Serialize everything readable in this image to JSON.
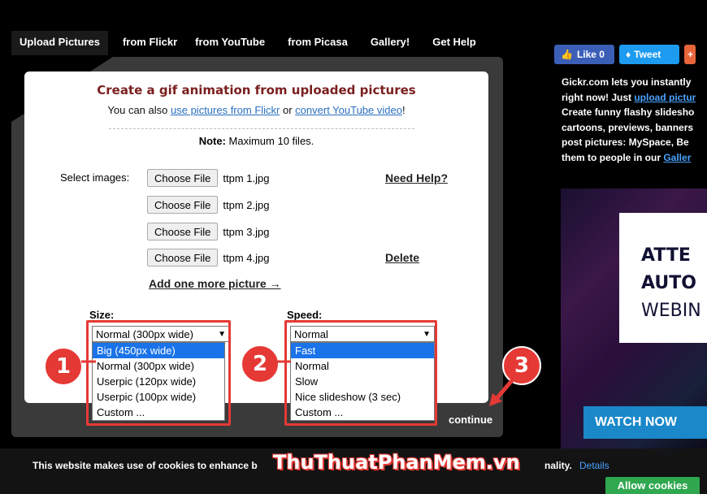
{
  "nav": [
    "Upload Pictures",
    "from Flickr",
    "from YouTube",
    "from Picasa",
    "Gallery!",
    "Get Help"
  ],
  "panel": {
    "title": "Create a gif animation from uploaded pictures",
    "sub_prefix": "You can also ",
    "link_flickr": "use pictures from Flickr",
    "sub_or": " or ",
    "link_youtube": "convert YouTube video",
    "sub_suffix": "!",
    "note_label": "Note:",
    "note_text": " Maximum 10 files.",
    "select_label": "Select images:",
    "choose_label": "Choose File",
    "files": [
      "ttpm 1.jpg",
      "ttpm 2.jpg",
      "ttpm 3.jpg",
      "ttpm 4.jpg"
    ],
    "need_help": "Need Help?",
    "delete": "Delete",
    "add_more": "Add one more picture →"
  },
  "size": {
    "label": "Size:",
    "selected": "Normal (300px wide)",
    "options": [
      "Big (450px wide)",
      "Normal (300px wide)",
      "Userpic (120px wide)",
      "Userpic (100px wide)",
      "Custom ..."
    ],
    "highlighted": 0
  },
  "speed": {
    "label": "Speed:",
    "selected": "Normal",
    "options": [
      "Fast",
      "Normal",
      "Slow",
      "Nice slideshow (3 sec)",
      "Custom ..."
    ],
    "highlighted": 0
  },
  "badges": [
    "1",
    "2",
    "3"
  ],
  "continue_label": "continue",
  "social": {
    "like": "Like 0",
    "tweet": "Tweet",
    "plus": "+"
  },
  "right_text": {
    "l1": "Gickr.com lets you instantly",
    "l2_prefix": "right now! Just ",
    "l2_link": "upload pictur",
    "l3": "Create funny flashy slidesho",
    "l4": "cartoons, previews, banners",
    "l5": "post pictures: MySpace, Be",
    "l6_prefix": "them to people in our ",
    "l6_link": "Galler"
  },
  "ad": {
    "line1": "ATTE",
    "line2": "AUTO",
    "line3": "WEBIN",
    "button": "WATCH NOW"
  },
  "cookie": {
    "text": "This website makes use of cookies to enhance b",
    "tail": "nality.",
    "details": "Details",
    "allow": "Allow cookies"
  },
  "watermark": "ThuThuatPhanMem.vn",
  "colors": {
    "accent_red": "#e53935",
    "highlight_blue": "#1a73e8",
    "allow_green": "#2fa84f",
    "title_red": "#7a1f1f"
  }
}
